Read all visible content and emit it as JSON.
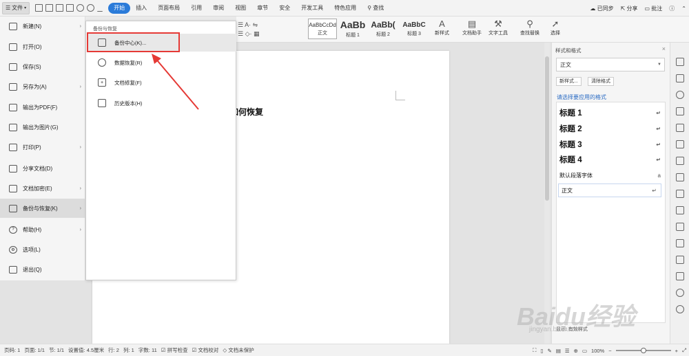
{
  "topbar": {
    "file_label": "文件",
    "tabs": [
      "开始",
      "插入",
      "页面布局",
      "引用",
      "审阅",
      "视图",
      "章节",
      "安全",
      "开发工具",
      "特色应用"
    ],
    "search_label": "查找",
    "sync_label": "已同步",
    "share_label": "分享",
    "comment_label": "批注",
    "accent": "#2b7bd9"
  },
  "ribbon": {
    "styles": [
      {
        "preview": "AaBbCcDd",
        "caption": "正文"
      },
      {
        "preview": "AaBb",
        "caption": "标题 1"
      },
      {
        "preview": "AaBb(",
        "caption": "标题 2"
      },
      {
        "preview": "AaBbC",
        "caption": "标题 3"
      }
    ],
    "new_style": "新样式",
    "doc_helper": "文档助手",
    "text_tools": "文字工具",
    "find_replace": "查找替换",
    "select": "选择"
  },
  "file_menu": [
    {
      "label": "新建(N)",
      "arrow": true,
      "icon": "new-doc-icon"
    },
    {
      "label": "打开(O)",
      "arrow": false,
      "icon": "folder-icon"
    },
    {
      "label": "保存(S)",
      "arrow": false,
      "icon": "save-icon"
    },
    {
      "label": "另存为(A)",
      "arrow": true,
      "icon": "save-as-icon"
    },
    {
      "label": "输出为PDF(F)",
      "arrow": false,
      "icon": "pdf-icon"
    },
    {
      "label": "输出为图片(G)",
      "arrow": false,
      "icon": "image-icon"
    },
    {
      "label": "打印(P)",
      "arrow": true,
      "icon": "printer-icon"
    },
    {
      "label": "分享文档(D)",
      "arrow": false,
      "icon": "share-icon"
    },
    {
      "label": "文档加密(E)",
      "arrow": true,
      "icon": "lock-icon"
    },
    {
      "label": "备份与恢复(K)",
      "arrow": true,
      "icon": "backup-icon"
    },
    {
      "label": "帮助(H)",
      "arrow": true,
      "icon": "help-icon"
    },
    {
      "label": "选项(L)",
      "arrow": false,
      "icon": "gear-icon"
    },
    {
      "label": "退出(Q)",
      "arrow": false,
      "icon": "exit-icon"
    }
  ],
  "submenu": {
    "header": "备份与恢复",
    "items": [
      {
        "label": "备份中心(K)...",
        "icon": "backup-center-icon"
      },
      {
        "label": "数据恢复(R)",
        "icon": "data-recovery-icon"
      },
      {
        "label": "文档修复(F)",
        "icon": "doc-repair-icon"
      },
      {
        "label": "历史版本(H)",
        "icon": "history-icon"
      }
    ]
  },
  "document": {
    "heading": "如何恢复"
  },
  "panel": {
    "title": "样式和格式",
    "current_style": "正文",
    "new_style_btn": "新样式...",
    "clear_format_btn": "清除格式",
    "apply_prompt": "请选择要应用的格式",
    "styles": [
      "标题  1",
      "标题  2",
      "标题  3",
      "标题  4"
    ],
    "default_font": "默认段落字体",
    "body_style": "正文",
    "footer_label": "显示: 有效样式"
  },
  "statusbar": {
    "page_code": "页码: 1",
    "page": "页面: 1/1",
    "section": "节: 1/1",
    "setting": "设置值: 4.5厘米",
    "row": "行: 2",
    "col": "列: 1",
    "words": "字数: 11",
    "spell": "拼写检查",
    "proof": "文档校对",
    "protect": "文档未保护",
    "zoom": "100%"
  },
  "watermark": {
    "text": "Baidu经验",
    "sub": "jingyan.baidu.com"
  }
}
